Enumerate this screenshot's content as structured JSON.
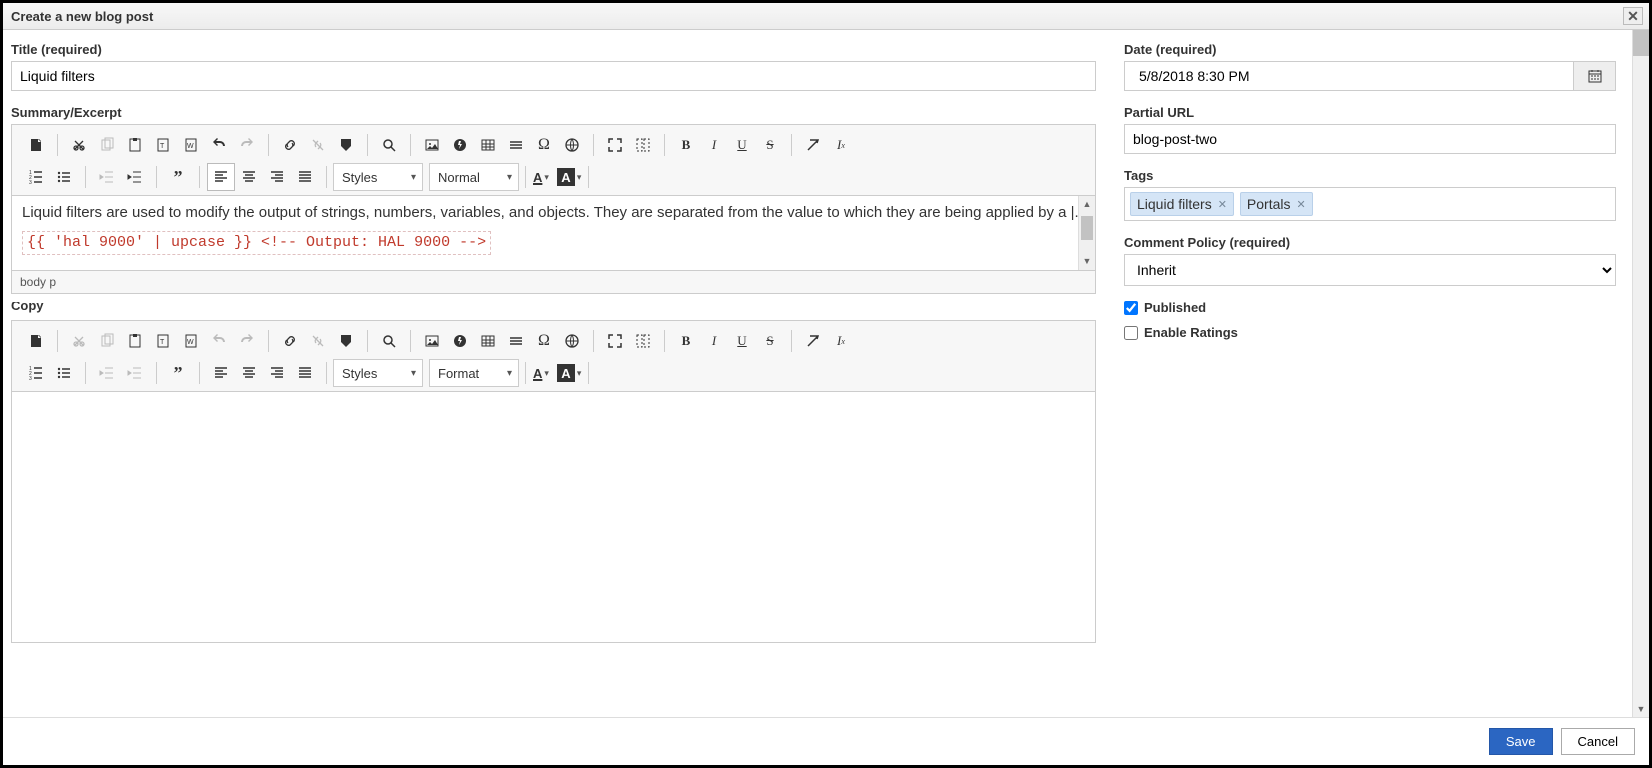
{
  "dialog": {
    "title": "Create a new blog post"
  },
  "labels": {
    "title": "Title (required)",
    "summary": "Summary/Excerpt",
    "copy": "Copy",
    "date": "Date (required)",
    "partial_url": "Partial URL",
    "tags": "Tags",
    "comment_policy": "Comment Policy (required)",
    "published": "Published",
    "enable_ratings": "Enable Ratings"
  },
  "values": {
    "title": "Liquid filters",
    "date": "5/8/2018 8:30 PM",
    "partial_url": "blog-post-two",
    "comment_policy": "Inherit",
    "published_checked": true,
    "enable_ratings_checked": false
  },
  "tags": [
    {
      "label": "Liquid filters"
    },
    {
      "label": "Portals"
    }
  ],
  "summary_editor": {
    "content_text": "Liquid filters are used to modify the output of strings, numbers, variables, and objects. They are separated from the value to which they are being applied by a |.",
    "code_line": "{{ 'hal 9000' | upcase }} <!-- Output: HAL 9000 -->",
    "status_path": "body  p"
  },
  "editor_controls": {
    "styles": "Styles",
    "format_normal": "Normal",
    "format_format": "Format"
  },
  "footer": {
    "save": "Save",
    "cancel": "Cancel"
  }
}
